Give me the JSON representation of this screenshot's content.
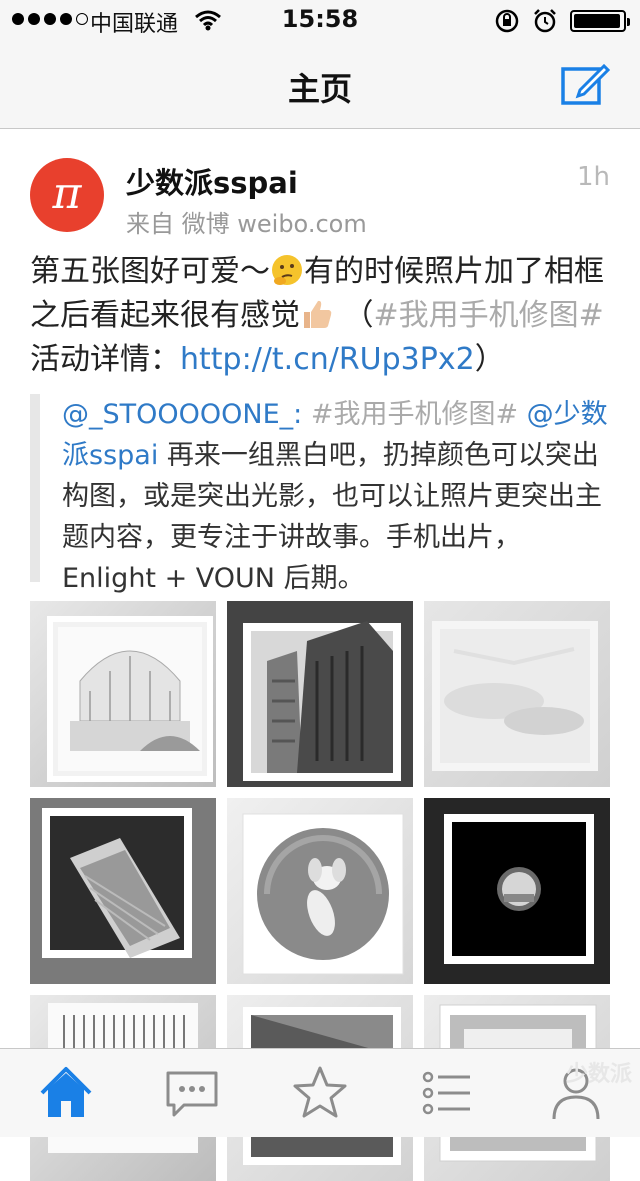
{
  "status_bar": {
    "carrier": "中国联通",
    "time": "15:58",
    "battery_level": 0.95
  },
  "nav": {
    "title": "主页",
    "compose_icon": "compose-icon"
  },
  "post": {
    "avatar_glyph": "π",
    "username": "少数派sspai",
    "time": "1h",
    "source": "来自 微博 weibo.com",
    "text_part1": "第五张图好可爱～",
    "text_part2": "有的时候照片加了相框之后看起来很有感觉",
    "text_part3": "（",
    "hashtag": "#我用手机修图#",
    "text_part4": "活动详情：",
    "link": "http://t.cn/RUp3Px2",
    "text_part5": "）"
  },
  "repost": {
    "mention1": "@_STOOOOONE_:",
    "hashtag": " #我用手机修图# ",
    "mention2": "@少数派sspai",
    "text": " 再来一组黑白吧，扔掉颜色可以突出构图，或是突出光影，也可以让照片更突出主题内容，更专注于讲故事。手机出片，Enlight + VOUN 后期。"
  },
  "images": [
    {
      "name": "photo-greenhouse"
    },
    {
      "name": "photo-building"
    },
    {
      "name": "photo-clouds"
    },
    {
      "name": "photo-window"
    },
    {
      "name": "photo-dog"
    },
    {
      "name": "photo-peephole"
    },
    {
      "name": "photo-lines"
    },
    {
      "name": "photo-texture"
    },
    {
      "name": "photo-frame"
    }
  ],
  "tabbar": {
    "tabs": [
      "home-icon",
      "messages-icon",
      "favorites-icon",
      "list-icon",
      "profile-icon"
    ],
    "active": "home-icon",
    "watermark": "少数派"
  },
  "colors": {
    "accent": "#1a80e6",
    "link": "#2f7ac7",
    "avatar_bg": "#e8402d"
  }
}
